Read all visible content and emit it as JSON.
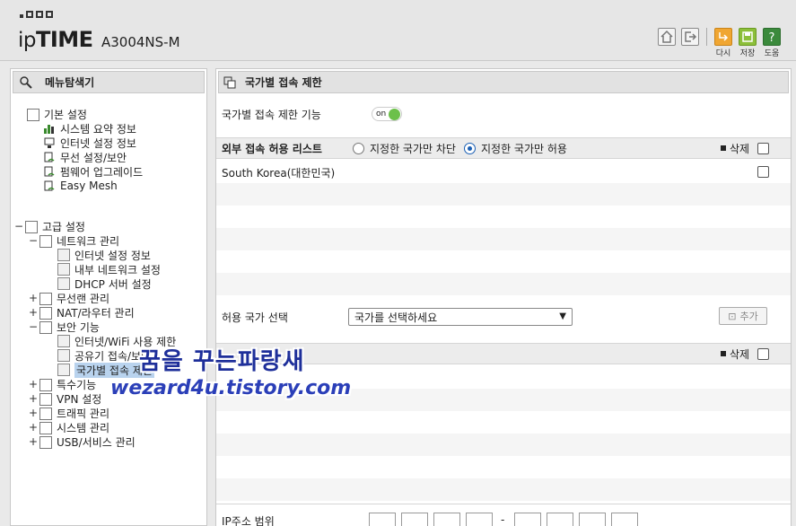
{
  "header": {
    "brand_prefix": "ip",
    "brand_bold": "TIME",
    "model": "A3004NS-M",
    "icons": [
      {
        "name": "home-icon",
        "label": ""
      },
      {
        "name": "logout-icon",
        "label": ""
      },
      {
        "name": "redo-icon",
        "label": "다시"
      },
      {
        "name": "save-icon",
        "label": "저장"
      },
      {
        "name": "help-icon",
        "label": "도움"
      }
    ]
  },
  "sidebar": {
    "title": "메뉴탐색기",
    "basic": {
      "label": "기본 설정",
      "items": [
        "시스템 요약 정보",
        "인터넷 설정 정보",
        "무선 설정/보안",
        "펌웨어 업그레이드",
        "Easy Mesh"
      ]
    },
    "advanced": {
      "toggle": "−",
      "label": "고급 설정",
      "network": {
        "toggle": "−",
        "label": "네트워크 관리",
        "items": [
          "인터넷 설정 정보",
          "내부 네트워크 설정",
          "DHCP 서버 설정"
        ]
      },
      "wireless": {
        "toggle": "+",
        "label": "무선랜 관리"
      },
      "nat": {
        "toggle": "+",
        "label": "NAT/라우터 관리"
      },
      "security": {
        "toggle": "−",
        "label": "보안 기능",
        "items": [
          "인터넷/WiFi 사용 제한",
          "공유기 접속/보안",
          "국가별 접속 제한"
        ]
      },
      "special": {
        "toggle": "+",
        "label": "특수기능"
      },
      "vpn": {
        "toggle": "+",
        "label": "VPN 설정"
      },
      "traffic": {
        "toggle": "+",
        "label": "트래픽 관리"
      },
      "system": {
        "toggle": "+",
        "label": "시스템 관리"
      },
      "usb": {
        "toggle": "+",
        "label": "USB/서비스 관리"
      }
    }
  },
  "main": {
    "title": "국가별 접속 제한",
    "feature_label": "국가별 접속 제한 기능",
    "toggle_text": "on",
    "list_title": "외부 접속 허용 리스트",
    "radio_block": "지정한 국가만 차단",
    "radio_allow": "지정한 국가만 허용",
    "delete_label": "삭제",
    "countries": [
      "South Korea(대한민국)"
    ],
    "country_select_label": "허용 국가 선택",
    "country_select_value": "국가를 선택하세요",
    "add_button": "추가",
    "delete_label2": "삭제",
    "ip_range_label": "IP주소 범위",
    "ip_separator": "-"
  },
  "watermark": {
    "line1": "꿈을 꾸는파랑새",
    "line2": "wezard4u.tistory.com"
  },
  "colors": {
    "toggle_on": "#6cc04a",
    "radio_selected": "#1a5fb4",
    "watermark": "#1e2f9a"
  }
}
